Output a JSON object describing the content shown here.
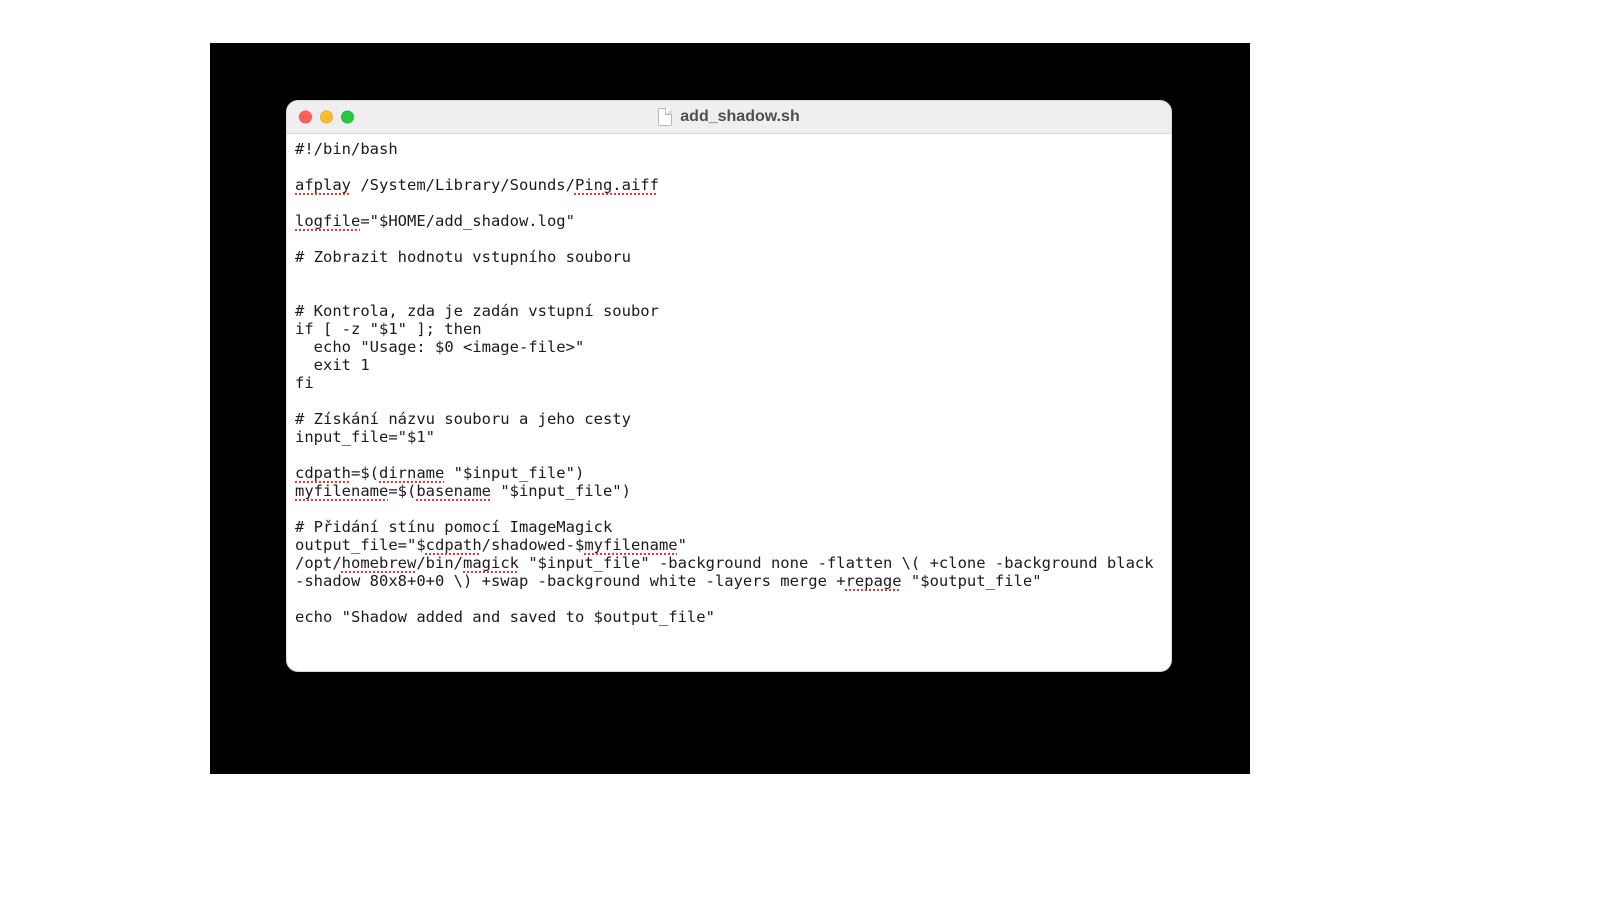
{
  "window": {
    "title": "add_shadow.sh",
    "traffic_lights": {
      "close": "close",
      "minimize": "minimize",
      "zoom": "zoom"
    },
    "doc_icon": "document-icon"
  },
  "colors": {
    "red": "#ff5f57",
    "yellow": "#febc2e",
    "green": "#28c840"
  },
  "spellcheck_words": [
    "afplay",
    "Ping.aiff",
    "logfile",
    "cdpath",
    "dirname",
    "myfilename",
    "basename",
    "cdpath",
    "myfilename",
    "homebrew",
    "magick",
    "repage"
  ],
  "script": {
    "lines": [
      "#!/bin/bash",
      "",
      "afplay /System/Library/Sounds/Ping.aiff",
      "",
      "logfile=\"$HOME/add_shadow.log\"",
      "",
      "# Zobrazit hodnotu vstupního souboru",
      "",
      "",
      "# Kontrola, zda je zadán vstupní soubor",
      "if [ -z \"$1\" ]; then",
      "  echo \"Usage: $0 <image-file>\"",
      "  exit 1",
      "fi",
      "",
      "# Získání názvu souboru a jeho cesty",
      "input_file=\"$1\"",
      "",
      "cdpath=$(dirname \"$input_file\")",
      "myfilename=$(basename \"$input_file\")",
      "",
      "# Přidání stínu pomocí ImageMagick",
      "output_file=\"$cdpath/shadowed-$myfilename\"",
      "/opt/homebrew/bin/magick \"$input_file\" -background none -flatten \\( +clone -background black -shadow 80x8+0+0 \\) +swap -background white -layers merge +repage \"$output_file\"",
      "",
      "echo \"Shadow added and saved to $output_file\""
    ]
  }
}
